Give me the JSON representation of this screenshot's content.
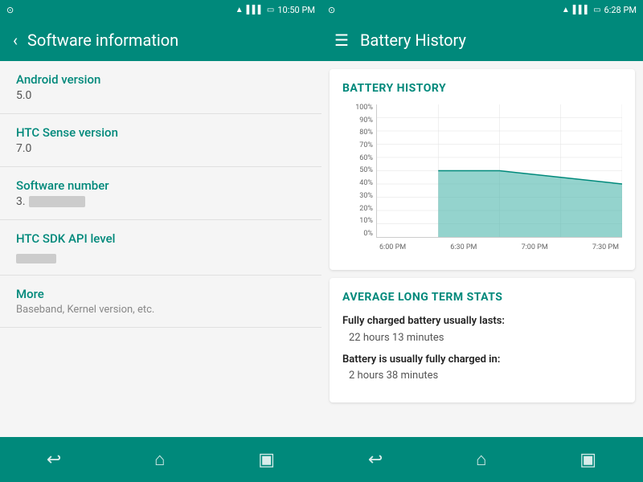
{
  "left": {
    "statusBar": {
      "time": "10:50 PM",
      "icons": [
        "wifi",
        "signal",
        "battery"
      ]
    },
    "appBar": {
      "title": "Software information",
      "backLabel": "‹"
    },
    "items": [
      {
        "label": "Android version",
        "value": "5.0",
        "blurred": false
      },
      {
        "label": "HTC Sense version",
        "value": "7.0",
        "blurred": false
      },
      {
        "label": "Software number",
        "value": "3.",
        "blurred": true
      },
      {
        "label": "HTC SDK API level",
        "value": "",
        "blurred": true
      },
      {
        "label": "More",
        "value": "",
        "subtext": "Baseband, Kernel version, etc.",
        "blurred": false
      }
    ],
    "navBar": {
      "back": "↩",
      "home": "⌂",
      "recent": "▣"
    }
  },
  "right": {
    "statusBar": {
      "time": "6:28 PM",
      "icons": [
        "wifi",
        "signal",
        "battery"
      ]
    },
    "appBar": {
      "title": "Battery History",
      "menuLabel": "☰"
    },
    "batteryChart": {
      "title": "BATTERY HISTORY",
      "yLabels": [
        "100%",
        "90%",
        "80%",
        "70%",
        "60%",
        "50%",
        "40%",
        "30%",
        "20%",
        "10%",
        "0%"
      ],
      "xLabels": [
        "6:00 PM",
        "6:30 PM",
        "7:00 PM",
        "7:30 PM"
      ],
      "accentColor": "#4db6ac"
    },
    "avgStats": {
      "title": "AVERAGE LONG TERM STATS",
      "stat1Label": "Fully charged battery usually lasts:",
      "stat1Value": "22 hours 13 minutes",
      "stat2Label": "Battery is usually fully charged in:",
      "stat2Value": "2 hours 38 minutes"
    },
    "navBar": {
      "back": "↩",
      "home": "⌂",
      "recent": "▣"
    }
  }
}
